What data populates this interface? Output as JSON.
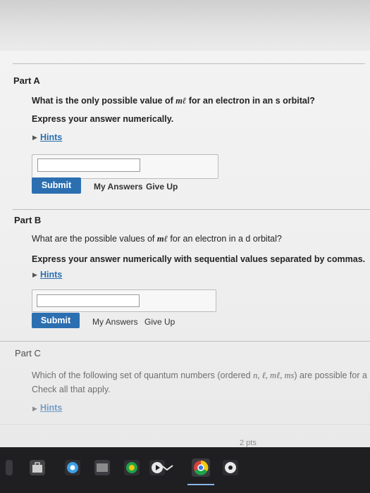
{
  "partA": {
    "title": "Part A",
    "question_pre": "What is the only possible value of ",
    "question_math": "mℓ",
    "question_post": " for an electron in an s orbital?",
    "instruction": "Express your answer numerically.",
    "hints_label": "Hints",
    "answer_value": "",
    "submit_label": "Submit",
    "my_answers_label": "My Answers",
    "give_up_label": "Give Up"
  },
  "partB": {
    "title": "Part B",
    "question_pre": "What are the possible values of ",
    "question_math": "mℓ",
    "question_post": " for an electron in a d orbital?",
    "instruction": "Express your answer numerically with sequential values separated by commas.",
    "hints_label": "Hints",
    "answer_value": "",
    "submit_label": "Submit",
    "my_answers_label": "My Answers",
    "give_up_label": "Give Up"
  },
  "partC": {
    "title": "Part C",
    "question_pre": "Which of the following set of quantum numbers (ordered ",
    "question_math": "n, ℓ, mℓ, ms",
    "question_post": ") are possible for a",
    "instruction": "Check all that apply.",
    "hints_label": "Hints",
    "points": "2 pts"
  },
  "taskbar": {
    "icons": [
      "windows-start-icon",
      "store-icon",
      "chrome-icon",
      "photos-icon",
      "firefox-icon",
      "mail-icon",
      "chrome-icon",
      "settings-icon"
    ]
  },
  "colors": {
    "accent": "#2c6fb1",
    "link": "#2a6fb0",
    "taskbar": "#1f1f22"
  }
}
